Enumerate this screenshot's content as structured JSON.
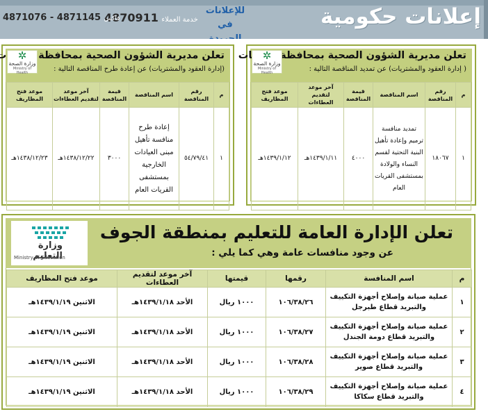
{
  "banner": {
    "title": "إعلانات حكومية",
    "promo_line1": "للإعلانات",
    "promo_line2": "في الجريدة",
    "service_label": "خدمة العملاء",
    "service_number": "4870911",
    "fax_label": "فاكس",
    "fax_numbers": "4871145 - 4871076"
  },
  "moh_logo": {
    "ar": "وزارة الصحة",
    "en": "Ministry of Health"
  },
  "ad_right": {
    "title": "تعلن مديرية الشؤون الصحية بمحافظة القريات",
    "subtitle": "( إدارة العقود والمشتريات) عن تمديد المناقصة التالية :",
    "headers": [
      "م",
      "رقم المناقصة",
      "اسم المناقصة",
      "قيمة المناقصة",
      "آخر موعد لتقديم العطاءات",
      "موعد فتح المظاريف"
    ],
    "rows": [
      [
        "١",
        "١٨٠٦٧",
        "تمديد منافسة ترميم وإعادة تأهيل البنية التحتية لقسم النساء والولادة بمستشفى القريات العام",
        "٤٠٠٠",
        "١٤٣٩/١/١١هـ",
        "١٤٣٩/١/١٢هـ"
      ]
    ]
  },
  "ad_left": {
    "title": "تعلن مديرية الشؤون الصحية بمحافظة القريات",
    "subtitle": "(إدارة العقود والمشتريات) عن إعادة طرح المناقصة التالية :",
    "headers": [
      "م",
      "رقم المناقصة",
      "اسم المناقصة",
      "قيمة المناقصة",
      "آخر موعد لتقديم العطاءات",
      "موعد فتح المظاريف"
    ],
    "rows": [
      [
        "١",
        "٥٤/٧٩/٤١",
        "إعادة طرح منافسة تأهيل مبنى العيادات الخارجية بمستشفى القريات العام",
        "٣٠٠٠",
        "١٤٣٨/١٢/٢٢هـ",
        "١٤٣٨/١٢/٢٣هـ"
      ]
    ]
  },
  "ad_edu": {
    "title": "تعلن الإدارة العامة للتعليم بمنطقة الجوف",
    "subtitle": "عن وجود منافسات عامة وهي كما يلي :",
    "logo_ar": "وزارة التعليم",
    "logo_en": "Ministry of Education",
    "headers": [
      "م",
      "اسم المنافسة",
      "رقمها",
      "قيمتها",
      "آخر موعد لتقديم العطاءات",
      "موعد فتح المظاريف"
    ],
    "rows": [
      [
        "١",
        "عملية صيانة وإصلاح أجهزة التكييف والتبريد قطاع طبرجل",
        "١٠٦/٣٨/٢٦",
        "١٠٠٠ ريال",
        "الأحد ١٤٣٩/١/١٨هـ",
        "الاثنين ١٤٣٩/١/١٩هـ"
      ],
      [
        "٢",
        "عملية صيانة وإصلاح أجهزة التكييف والتبريد قطاع دومة الجندل",
        "١٠٦/٣٨/٢٧",
        "١٠٠٠ ريال",
        "الأحد ١٤٣٩/١/١٨هـ",
        "الاثنين ١٤٣٩/١/١٩هـ"
      ],
      [
        "٣",
        "عملية صيانة وإصلاح أجهزة التكييف والتبريد قطاع صوير",
        "١٠٦/٣٨/٢٨",
        "١٠٠٠ ريال",
        "الأحد ١٤٣٩/١/١٨هـ",
        "الاثنين ١٤٣٩/١/١٩هـ"
      ],
      [
        "٤",
        "عملية صيانة وإصلاح أجهزة التكييف والتبريد قطاع سكاكا",
        "١٠٦/٣٨/٢٩",
        "١٠٠٠ ريال",
        "الأحد ١٤٣٩/١/١٨هـ",
        "الاثنين ١٤٣٩/١/١٩هـ"
      ]
    ]
  }
}
